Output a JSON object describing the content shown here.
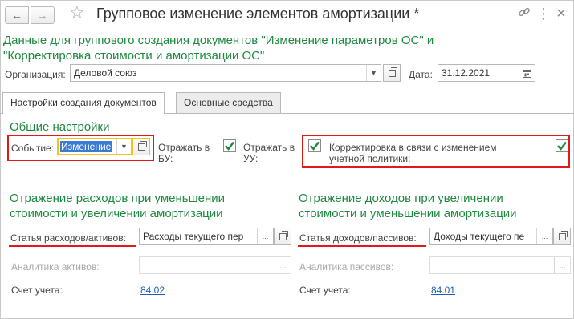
{
  "window": {
    "title": "Групповое изменение элементов амортизации *",
    "back_icon": "←",
    "forward_icon": "→",
    "favorite_icon": "☆",
    "link_icon": "🔗",
    "menu_icon": "⋮",
    "close_icon": "×"
  },
  "header": {
    "subtitle_line1": "Данные для группового создания документов \"Изменение параметров ОС\" и",
    "subtitle_line2": "\"Корректировка стоимости и амортизации ОС\"",
    "organization_label": "Организация:",
    "organization_value": "Деловой союз",
    "date_label": "Дата:",
    "date_value": "31.12.2021"
  },
  "tabs": [
    {
      "label": "Настройки создания документов",
      "active": true
    },
    {
      "label": "Основные средства",
      "active": false
    }
  ],
  "general": {
    "title": "Общие настройки",
    "event_label": "Событие:",
    "event_value": "Изменение",
    "reflect_bu_line1": "Отражать в",
    "reflect_bu_line2": "БУ:",
    "reflect_bu_checked": true,
    "reflect_uu_line1": "Отражать в",
    "reflect_uu_line2": "УУ:",
    "reflect_uu_checked": true,
    "correction_checked": true,
    "correction_line1": "Корректировка в связи с изменением",
    "correction_line2": "учетной политики:",
    "correction_right_checked": true
  },
  "expenses": {
    "title_line1": "Отражение расходов при уменьшении",
    "title_line2": "стоимости и увеличении амортизации",
    "item_label": "Статья расходов/активов:",
    "item_value": "Расходы текущего пер",
    "analytics_label": "Аналитика активов:",
    "analytics_value": "",
    "account_label": "Счет учета:",
    "account_value": "84.02"
  },
  "income": {
    "title_line1": "Отражение доходов при увеличении",
    "title_line2": "стоимости и уменьшении амортизации",
    "item_label": "Статья доходов/пассивов:",
    "item_value": "Доходы текущего пе",
    "analytics_label": "Аналитика пассивов:",
    "analytics_value": "",
    "account_label": "Счет учета:",
    "account_value": "84.01"
  },
  "colors": {
    "accent_green": "#1d8a3e",
    "highlight_red": "#e01a1a",
    "link_blue": "#1d5fb4",
    "selection_blue": "#3a7bd5",
    "focus_yellow": "#f0c419"
  }
}
